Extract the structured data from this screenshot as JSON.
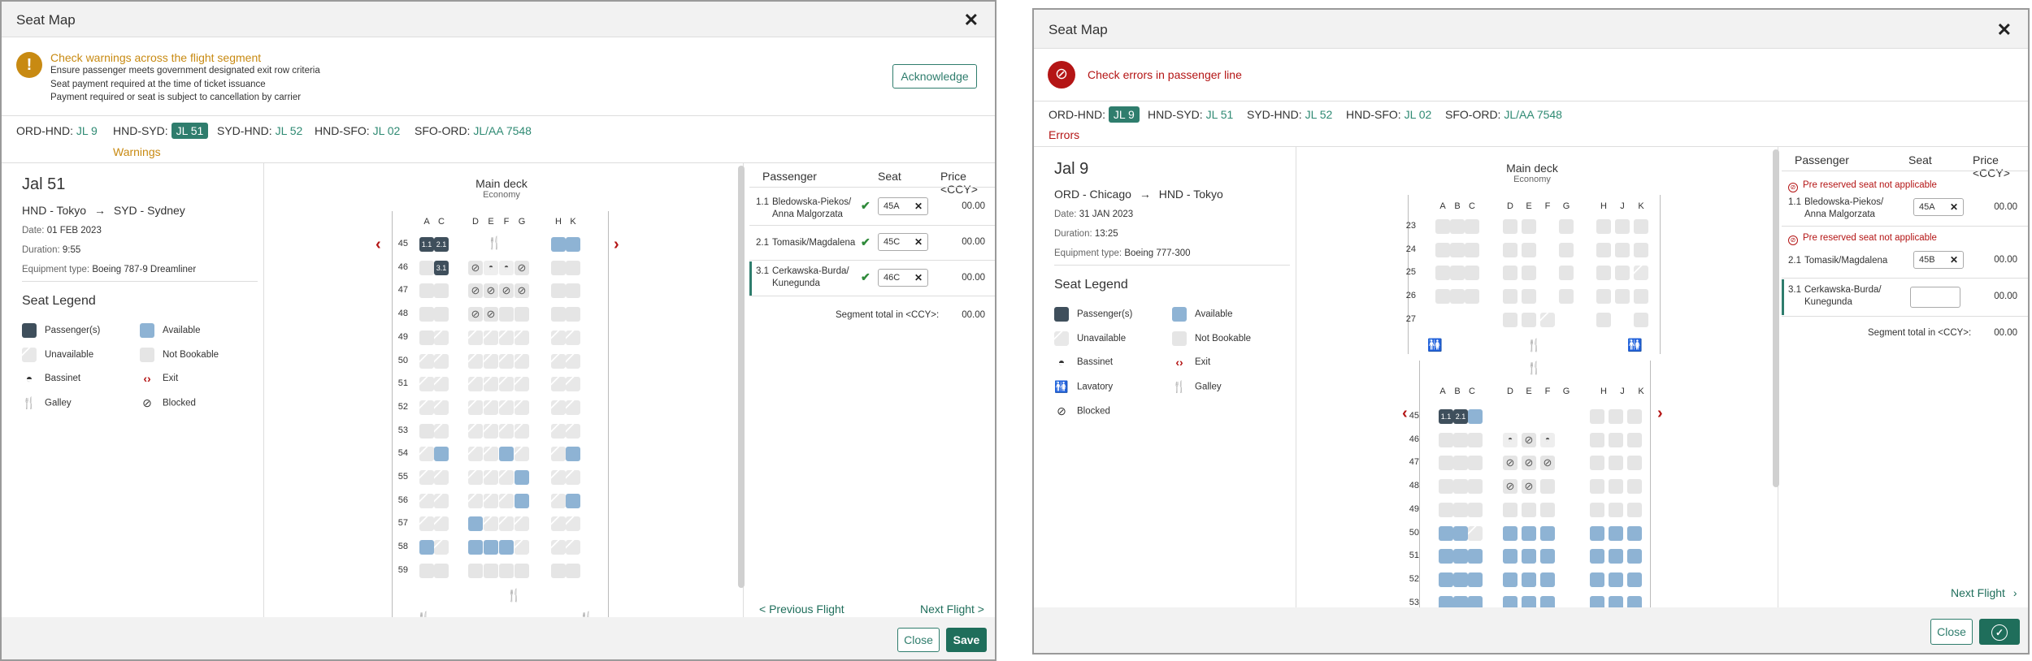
{
  "left": {
    "title": "Seat Map",
    "close_icon": "close-icon",
    "warning": {
      "icon": "warning-icon",
      "title": "Check warnings across the flight segment",
      "lines": [
        "Ensure passenger meets government designated exit row criteria",
        "Seat payment required at the time of ticket issuance",
        "Payment required or seat is subject to cancellation by carrier"
      ],
      "ack": "Acknowledge"
    },
    "segments": [
      {
        "label": "ORD-HND:",
        "code": "JL 9"
      },
      {
        "label": "HND-SYD:",
        "code": "JL 51"
      },
      {
        "label": "SYD-HND:",
        "code": "JL 52"
      },
      {
        "label": "HND-SFO:",
        "code": "JL 02"
      },
      {
        "label": "SFO-ORD:",
        "code": "JL/AA 7548"
      }
    ],
    "segment_note": "Warnings",
    "flight": {
      "name": "Jal 51",
      "from": "HND - Tokyo",
      "to": "SYD - Sydney",
      "date_label": "Date:",
      "date": "01 FEB 2023",
      "dur_label": "Duration:",
      "dur": "9:55",
      "eq_label": "Equipment type:",
      "eq": "Boeing 787-9 Dreamliner"
    },
    "legend": {
      "title": "Seat Legend",
      "passenger": "Passenger(s)",
      "available": "Available",
      "unavailable": "Unavailable",
      "not_bookable": "Not Bookable",
      "bassinet": "Bassinet",
      "exit": "Exit",
      "galley": "Galley",
      "blocked": "Blocked"
    },
    "deck": {
      "name": "Main deck",
      "cabin": "Economy"
    },
    "columns": [
      "A",
      "C",
      "D",
      "E",
      "F",
      "G",
      "H",
      "K"
    ],
    "rows": [
      "45",
      "46",
      "47",
      "48",
      "49",
      "50",
      "51",
      "52",
      "53",
      "54",
      "55",
      "56",
      "57",
      "58",
      "59"
    ],
    "table": {
      "h_passenger": "Passenger",
      "h_seat": "Seat",
      "h_price": "Price <CCY>",
      "pax": [
        {
          "num": "1.1",
          "name1": "Bledowska-Piekos/",
          "name2": "Anna Malgorzata",
          "seat": "45A",
          "price": "00.00"
        },
        {
          "num": "2.1",
          "name1": "Tomasik/Magdalena",
          "name2": "",
          "seat": "45C",
          "price": "00.00"
        },
        {
          "num": "3.1",
          "name1": "Cerkawska-Burda/",
          "name2": "Kunegunda",
          "seat": "46C",
          "price": "00.00"
        }
      ],
      "total_label": "Segment total in <CCY>:",
      "total": "00.00"
    },
    "prev": "< Previous Flight",
    "next": "Next Flight >",
    "close": "Close",
    "save": "Save"
  },
  "right": {
    "title": "Seat Map",
    "close_icon": "close-icon",
    "error": {
      "icon": "blocked-circle-icon",
      "title": "Check errors in passenger line"
    },
    "segments": [
      {
        "label": "ORD-HND:",
        "code": "JL 9"
      },
      {
        "label": "HND-SYD:",
        "code": "JL 51"
      },
      {
        "label": "SYD-HND:",
        "code": "JL 52"
      },
      {
        "label": "HND-SFO:",
        "code": "JL 02"
      },
      {
        "label": "SFO-ORD:",
        "code": "JL/AA 7548"
      }
    ],
    "segment_note": "Errors",
    "flight": {
      "name": "Jal 9",
      "from": "ORD - Chicago",
      "to": "HND - Tokyo",
      "date_label": "Date:",
      "date": "31 JAN 2023",
      "dur_label": "Duration:",
      "dur": "13:25",
      "eq_label": "Equipment type:",
      "eq": "Boeing 777-300"
    },
    "legend": {
      "title": "Seat Legend",
      "passenger": "Passenger(s)",
      "available": "Available",
      "unavailable": "Unavailable",
      "not_bookable": "Not Bookable",
      "bassinet": "Bassinet",
      "exit": "Exit",
      "lavatory": "Lavatory",
      "galley": "Galley",
      "blocked": "Blocked"
    },
    "deck": {
      "name": "Main deck",
      "cabin": "Economy"
    },
    "columns": [
      "A",
      "B",
      "C",
      "D",
      "E",
      "F",
      "G",
      "H",
      "J",
      "K"
    ],
    "rows_top": [
      "23",
      "24",
      "25",
      "26",
      "27"
    ],
    "rows": [
      "45",
      "46",
      "47",
      "48",
      "49",
      "50",
      "51",
      "52",
      "53"
    ],
    "table": {
      "h_passenger": "Passenger",
      "h_seat": "Seat",
      "h_price": "Price <CCY>",
      "err_msg": "Pre reserved seat not applicable",
      "pax": [
        {
          "num": "1.1",
          "name1": "Bledowska-Piekos/",
          "name2": "Anna Malgorzata",
          "seat": "45A",
          "price": "00.00"
        },
        {
          "num": "2.1",
          "name1": "Tomasik/Magdalena",
          "name2": "",
          "seat": "45B",
          "price": "00.00"
        },
        {
          "num": "3.1",
          "name1": "Cerkawska-Burda/",
          "name2": "Kunegunda",
          "seat": "",
          "price": "00.00"
        }
      ],
      "total_label": "Segment total in <CCY>:",
      "total": "00.00"
    },
    "next": "Next Flight",
    "close": "Close",
    "confirm_icon": "checkmark-circle-icon"
  },
  "colors": {
    "accent": "#2f7d6d",
    "warning": "#c88a12",
    "error": "#b41515",
    "available": "#8eb3d4",
    "passenger": "#3f4f5c"
  }
}
